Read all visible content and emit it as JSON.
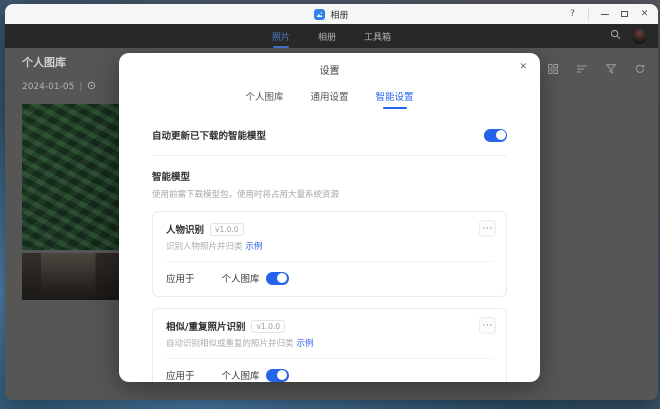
{
  "colors": {
    "accent": "#2563eb",
    "titlebar_bg": "#f6f6f7",
    "tabbar_bg": "#282828",
    "content_bg": "#565656",
    "active_tab_dark": "#4a7cc9"
  },
  "titlebar": {
    "app_name": "相册",
    "help_icon": "?",
    "close_icon": "✕"
  },
  "tabbar": {
    "tabs": [
      {
        "label": "照片",
        "active": true
      },
      {
        "label": "相册",
        "active": false
      },
      {
        "label": "工具箱",
        "active": false
      }
    ]
  },
  "library": {
    "title": "个人图库",
    "date": "2024-01-05",
    "date_separator": "|"
  },
  "modal": {
    "title": "设置",
    "close_icon": "✕",
    "tabs": [
      {
        "label": "个人图库",
        "active": false
      },
      {
        "label": "通用设置",
        "active": false
      },
      {
        "label": "智能设置",
        "active": true
      }
    ],
    "auto_update": {
      "label": "自动更新已下载的智能模型",
      "enabled": true
    },
    "section": {
      "title": "智能模型",
      "subtitle": "使用前需下载模型包，使用时将占用大量系统资源"
    },
    "cards": [
      {
        "title": "人物识别",
        "version": "v1.0.0",
        "more_icon": "⋯",
        "description": "识别人物照片并归类",
        "example_link": "示例",
        "apply_label": "应用于",
        "apply_target": "个人图库",
        "enabled": true
      },
      {
        "title": "相似/重复照片识别",
        "version": "v1.0.0",
        "more_icon": "⋯",
        "description": "自动识别相似或重复的照片并归类",
        "example_link": "示例",
        "apply_label": "应用于",
        "apply_target": "个人图库",
        "enabled": true
      }
    ]
  }
}
